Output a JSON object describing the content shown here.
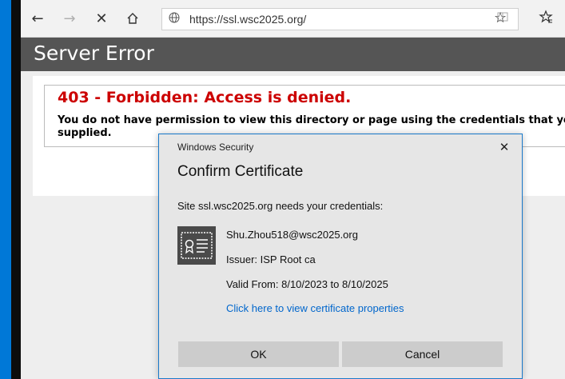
{
  "browser": {
    "url": "https://ssl.wsc2025.org/"
  },
  "page": {
    "header_title": "Server Error",
    "error_title": "403 - Forbidden: Access is denied.",
    "error_message": "You do not have permission to view this directory or page using the credentials that you supplied."
  },
  "dialog": {
    "caption": "Windows Security",
    "title": "Confirm Certificate",
    "prompt": "Site ssl.wsc2025.org needs your credentials:",
    "certificate": {
      "subject": "Shu.Zhou518@wsc2025.org",
      "issuer": "Issuer: ISP Root ca",
      "valid": "Valid From: 8/10/2023 to 8/10/2025"
    },
    "link": "Click here to view certificate properties",
    "ok_label": "OK",
    "cancel_label": "Cancel"
  },
  "colors": {
    "error_red": "#cc0000",
    "link_blue": "#0066cc",
    "dialog_border": "#1979ca",
    "header_gray": "#555555"
  }
}
